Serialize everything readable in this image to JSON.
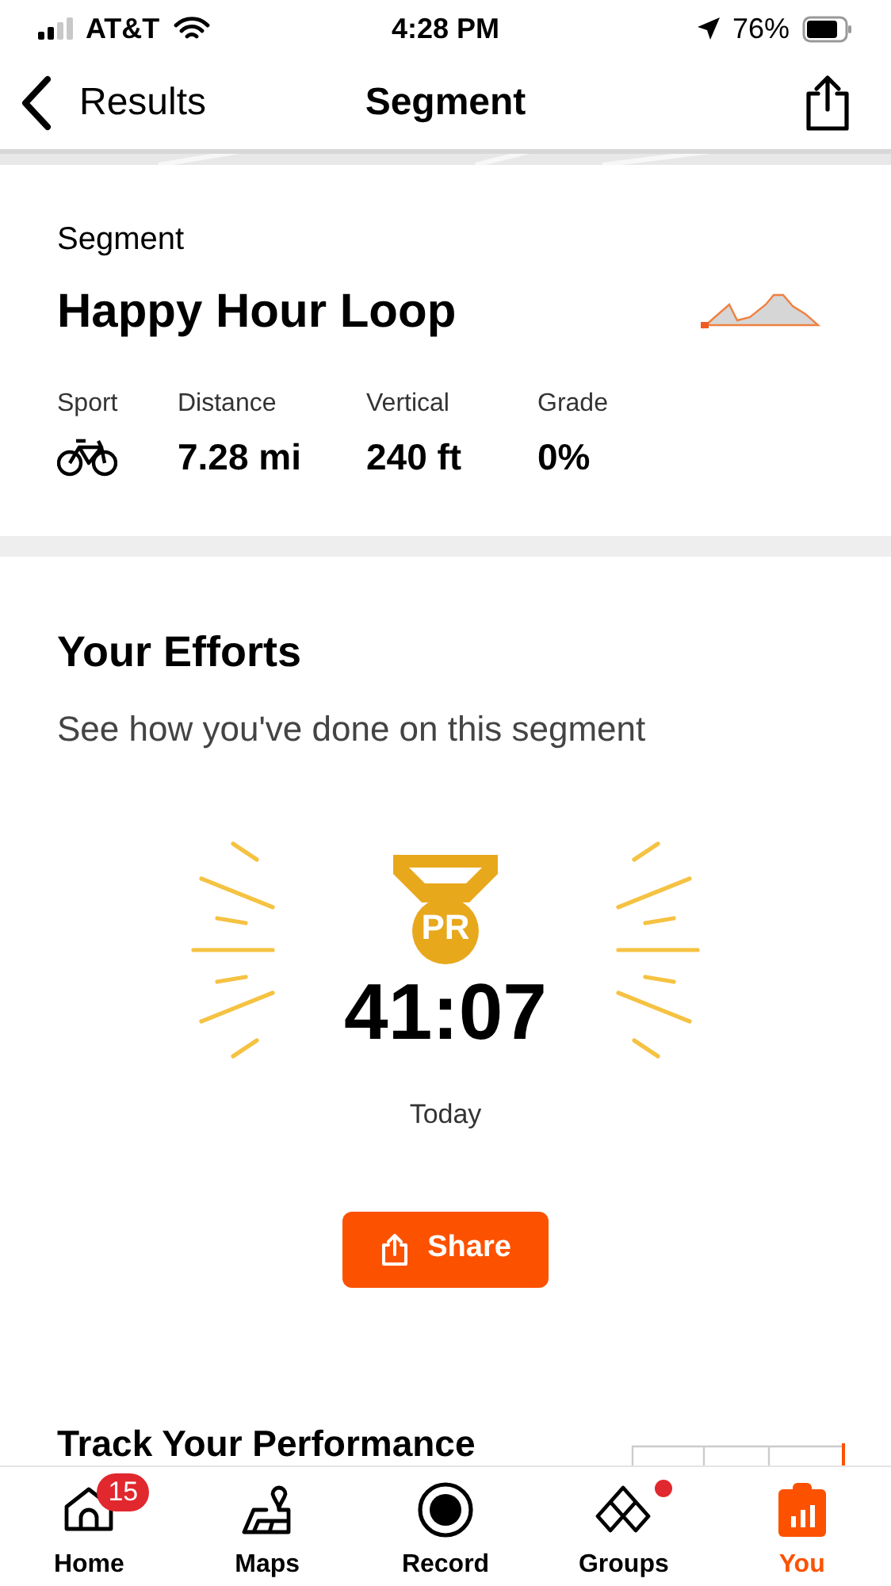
{
  "status_bar": {
    "carrier": "AT&T",
    "time": "4:28 PM",
    "battery": "76%"
  },
  "nav": {
    "back": "Results",
    "title": "Segment"
  },
  "segment": {
    "label": "Segment",
    "name": "Happy Hour Loop",
    "stats": [
      {
        "label": "Sport",
        "kind": "icon"
      },
      {
        "label": "Distance",
        "kind": "text",
        "value": "7.28 mi"
      },
      {
        "label": "Vertical",
        "kind": "text",
        "value": "240 ft"
      },
      {
        "label": "Grade",
        "kind": "text",
        "value": "0%"
      }
    ]
  },
  "efforts": {
    "title": "Your Efforts",
    "subtitle": "See how you've done on this segment",
    "badge": "PR",
    "time": "41:07",
    "date": "Today",
    "share": "Share"
  },
  "performance": {
    "title": "Track Your Performance"
  },
  "tabs": [
    {
      "label": "Home",
      "selected": false,
      "badge": "15",
      "dot": false
    },
    {
      "label": "Maps",
      "selected": false,
      "dot": false
    },
    {
      "label": "Record",
      "selected": false,
      "dot": false
    },
    {
      "label": "Groups",
      "selected": false,
      "dot": true
    },
    {
      "label": "You",
      "selected": true,
      "dot": false
    }
  ]
}
